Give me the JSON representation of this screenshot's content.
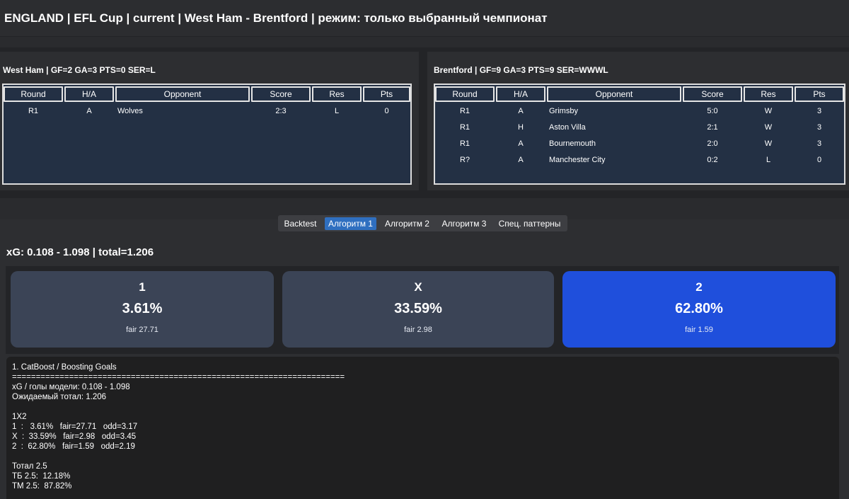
{
  "header": {
    "title": "ENGLAND | EFL Cup | current   |   West Ham - Brentford   |   режим: только выбранный чемпионат"
  },
  "columns": [
    "Round",
    "H/A",
    "Opponent",
    "Score",
    "Res",
    "Pts"
  ],
  "home_team": {
    "title": "West Ham | GF=2 GA=3 PTS=0 SER=L",
    "rows": [
      {
        "round": "R1",
        "ha": "A",
        "opponent": "Wolves",
        "score": "2:3",
        "res": "L",
        "pts": "0"
      }
    ]
  },
  "away_team": {
    "title": "Brentford | GF=9 GA=3 PTS=9 SER=WWWL",
    "rows": [
      {
        "round": "R1",
        "ha": "A",
        "opponent": "Grimsby",
        "score": "5:0",
        "res": "W",
        "pts": "3"
      },
      {
        "round": "R1",
        "ha": "H",
        "opponent": "Aston Villa",
        "score": "2:1",
        "res": "W",
        "pts": "3"
      },
      {
        "round": "R1",
        "ha": "A",
        "opponent": "Bournemouth",
        "score": "2:0",
        "res": "W",
        "pts": "3"
      },
      {
        "round": "R?",
        "ha": "A",
        "opponent": "Manchester City",
        "score": "0:2",
        "res": "L",
        "pts": "0"
      }
    ]
  },
  "tabs": [
    {
      "label": "Backtest",
      "active": false
    },
    {
      "label": "Алгоритм 1",
      "active": true
    },
    {
      "label": "Алгоритм 2",
      "active": false
    },
    {
      "label": "Алгоритм 3",
      "active": false
    },
    {
      "label": "Спец. паттерны",
      "active": false
    }
  ],
  "xg_summary": "xG: 0.108 - 1.098 | total=1.206",
  "outcomes": [
    {
      "label": "1",
      "pct": "3.61%",
      "fair": "fair 27.71",
      "highlight": false
    },
    {
      "label": "X",
      "pct": "33.59%",
      "fair": "fair 2.98",
      "highlight": false
    },
    {
      "label": "2",
      "pct": "62.80%",
      "fair": "fair 1.59",
      "highlight": true
    }
  ],
  "colors": {
    "accent": "#1f4fdc",
    "card": "#3b4456",
    "tab_active": "#2f6fc0",
    "table_bg": "#233044"
  },
  "log_lines": [
    "1. CatBoost / Boosting Goals",
    "======================================================================",
    "xG / голы модели: 0.108 - 1.098",
    "Ожидаемый тотал: 1.206",
    "",
    "1X2",
    "1  :   3.61%   fair=27.71   odd=3.17",
    "X  :  33.59%   fair=2.98   odd=3.45",
    "2  :  62.80%   fair=1.59   odd=2.19",
    "",
    "Тотал 2.5",
    "ТБ 2.5:  12.18%",
    "ТМ 2.5:  87.82%"
  ]
}
